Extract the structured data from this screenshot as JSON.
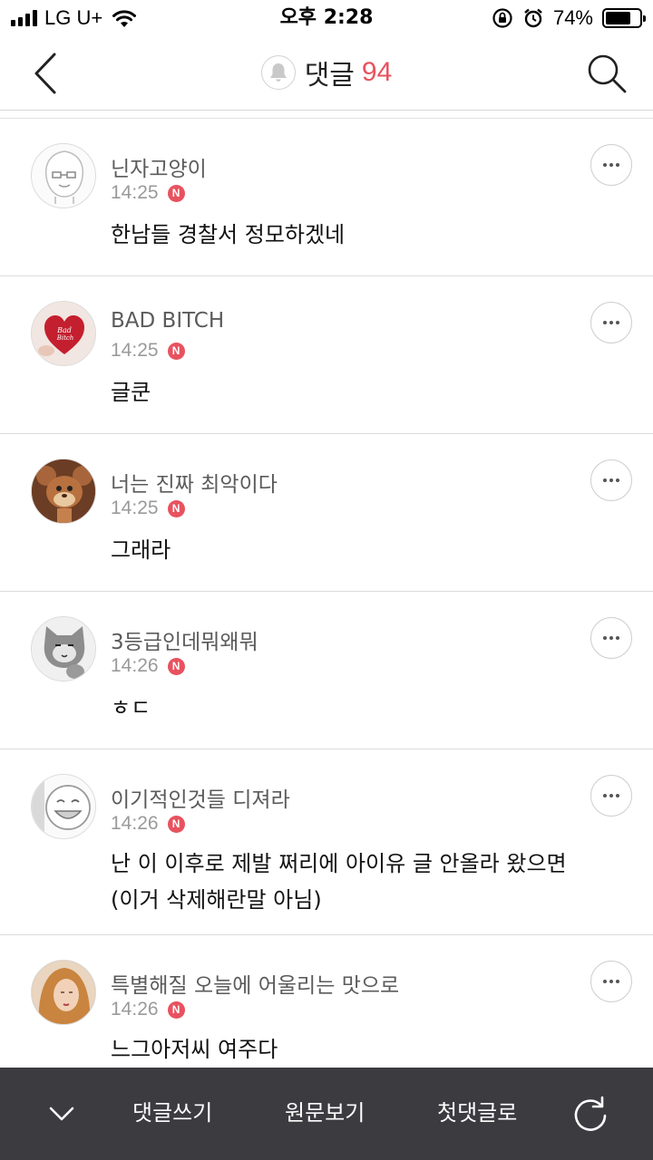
{
  "status_bar": {
    "carrier": "LG U+",
    "time": "오후 2:28",
    "battery_percent": "74%",
    "battery_level": 0.74
  },
  "header": {
    "title": "댓글",
    "count": "94",
    "icons": [
      "back-icon",
      "bell-icon",
      "search-icon"
    ],
    "accent_color": "#e8525f"
  },
  "comments": [
    {
      "nickname": "닌자고양이",
      "time": "14:25",
      "badge": "N",
      "text": "한남들 경찰서 정모하겠네"
    },
    {
      "nickname": "BAD BITCH",
      "time": "14:25",
      "badge": "N",
      "text": "글쿤"
    },
    {
      "nickname": "너는 진짜 최악이다",
      "time": "14:25",
      "badge": "N",
      "text": "그래라"
    },
    {
      "nickname": "3등급인데뭐왜뭐",
      "time": "14:26",
      "badge": "N",
      "text": "ㅎㄷ"
    },
    {
      "nickname": "이기적인것들 디져라",
      "time": "14:26",
      "badge": "N",
      "text_lines": [
        "난 이 이후로 제발 쩌리에 아이유 글 안올라 왔으면",
        "(이거 삭제해란말 아님)"
      ]
    },
    {
      "nickname": "특별해질 오늘에 어울리는 맛으로",
      "time": "14:26",
      "badge": "N",
      "text": "느그아저씨 여주다"
    }
  ],
  "bottom_bar": {
    "write_comment": "댓글쓰기",
    "view_original": "원문보기",
    "first_comment": "첫댓글로",
    "icons": [
      "chevron-down-icon",
      "refresh-icon"
    ]
  }
}
